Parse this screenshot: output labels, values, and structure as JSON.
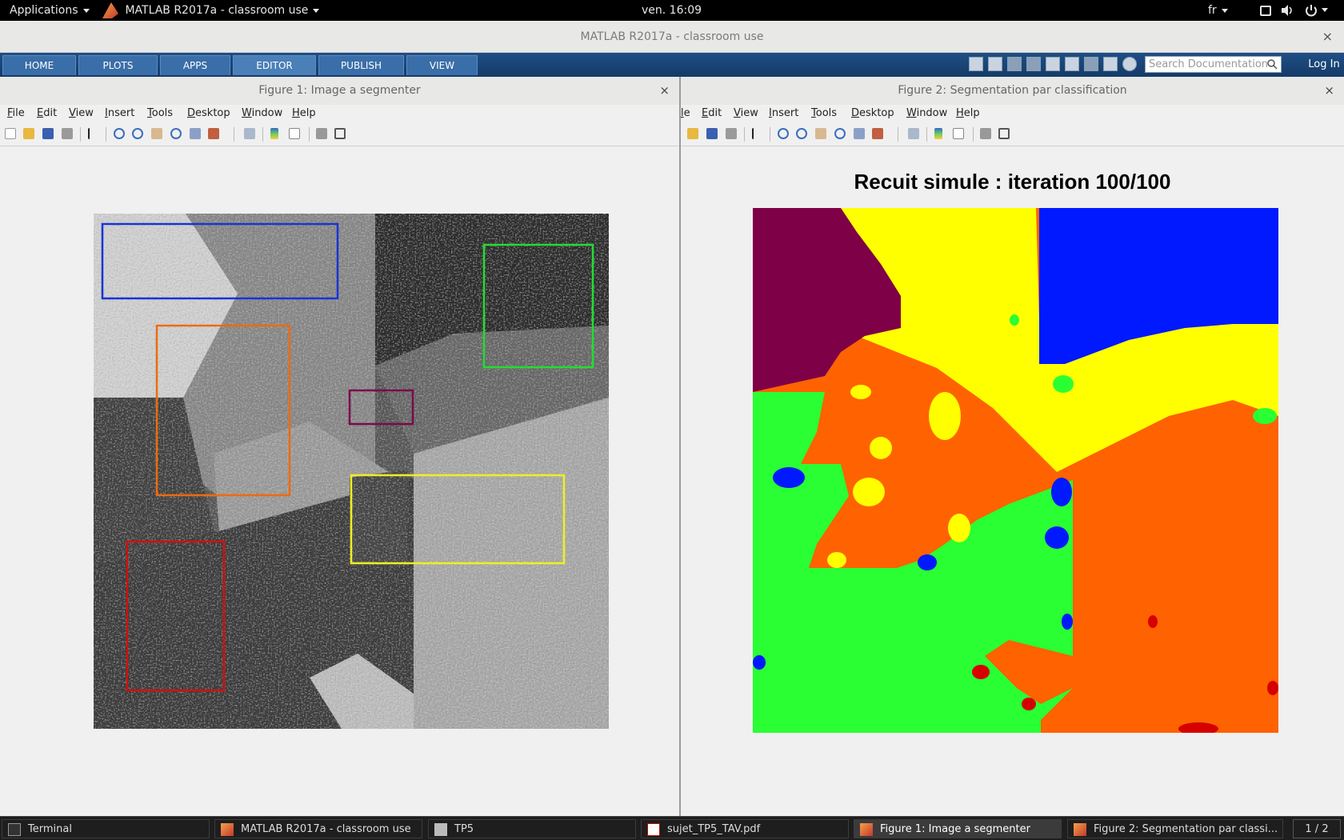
{
  "topbar": {
    "applications": "Applications",
    "active_app": "MATLAB R2017a - classroom use",
    "clock": "ven. 16:09",
    "language": "fr"
  },
  "main_window": {
    "title": "MATLAB R2017a - classroom use",
    "close": "×"
  },
  "toolstrip": {
    "tabs": [
      "HOME",
      "PLOTS",
      "APPS",
      "EDITOR",
      "PUBLISH",
      "VIEW"
    ],
    "search_placeholder": "Search Documentation",
    "login": "Log In"
  },
  "figure1": {
    "title": "Figure 1: Image a segmenter",
    "close": "×",
    "menu": [
      "File",
      "Edit",
      "View",
      "Insert",
      "Tools",
      "Desktop",
      "Window",
      "Help"
    ],
    "roi_colors": [
      "#1a33d6",
      "#22dd33",
      "#ee6a10",
      "#7a0a4a",
      "#f0f020",
      "#d01010"
    ]
  },
  "figure2": {
    "title": "Figure 2: Segmentation par classification",
    "close": "×",
    "menu": [
      "le",
      "Edit",
      "View",
      "Insert",
      "Tools",
      "Desktop",
      "Window",
      "Help"
    ],
    "plot_title": "Recuit simule : iteration 100/100",
    "class_colors": {
      "purple": "#7e0047",
      "yellow": "#ffff00",
      "blue": "#0019ff",
      "orange": "#ff6200",
      "green": "#29ff33",
      "red": "#d60000"
    }
  },
  "taskbar": {
    "items": [
      "Terminal",
      "MATLAB R2017a - classroom use",
      "TP5",
      "sujet_TP5_TAV.pdf",
      "Figure 1: Image a segmenter",
      "Figure 2: Segmentation par classi..."
    ],
    "pager": "1 / 2"
  }
}
